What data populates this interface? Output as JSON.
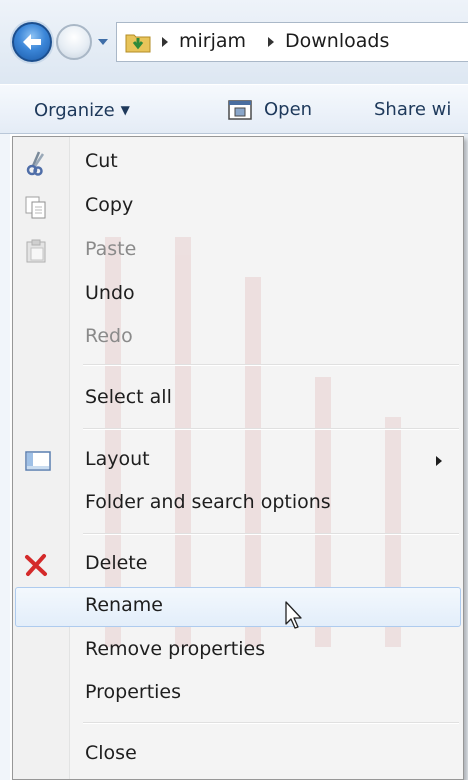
{
  "addressbar": {
    "crumbs": [
      "mirjam",
      "Downloads"
    ]
  },
  "toolbar": {
    "organize_label": "Organize",
    "open_label": "Open",
    "share_label": "Share wi"
  },
  "menu": {
    "items": [
      {
        "label": "Cut",
        "icon": "scissors-icon",
        "enabled": true
      },
      {
        "label": "Copy",
        "icon": "copy-icon",
        "enabled": true
      },
      {
        "label": "Paste",
        "icon": "paste-icon",
        "enabled": false
      },
      {
        "label": "Undo",
        "enabled": true
      },
      {
        "label": "Redo",
        "enabled": false
      },
      {
        "label": "Select all",
        "enabled": true
      },
      {
        "label": "Layout",
        "icon": "layout-icon",
        "enabled": true,
        "submenu": true
      },
      {
        "label": "Folder and search options",
        "enabled": true
      },
      {
        "label": "Delete",
        "icon": "delete-x-icon",
        "enabled": true
      },
      {
        "label": "Rename",
        "enabled": true,
        "highlighted": true
      },
      {
        "label": "Remove properties",
        "enabled": true
      },
      {
        "label": "Properties",
        "enabled": true
      },
      {
        "label": "Close",
        "enabled": true
      }
    ]
  },
  "colors": {
    "highlight_border": "#aecbee",
    "disabled_text": "#8a8a8a",
    "delete_icon": "#d42a2a"
  }
}
